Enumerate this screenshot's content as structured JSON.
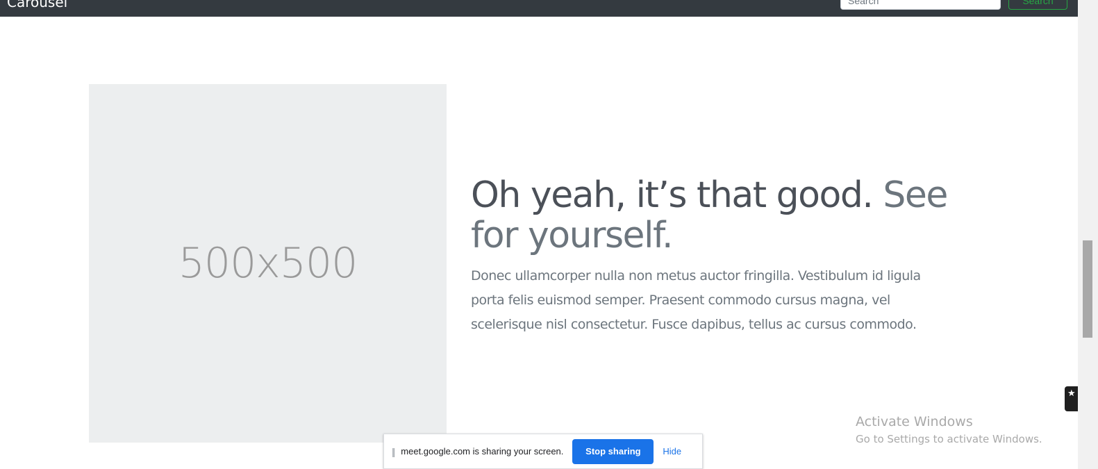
{
  "navbar": {
    "brand": "Carousel",
    "search_placeholder": "Search",
    "search_button": "Search"
  },
  "featurette": {
    "image_label": "500x500",
    "heading_main": "Oh yeah, it’s that good.",
    "heading_muted": "See for yourself.",
    "lead": "Donec ullamcorper nulla non metus auctor fringilla. Vestibulum id ligula porta felis euismod semper. Praesent commodo cursus magna, vel scelerisque nisl consectetur. Fusce dapibus, tellus ac cursus commodo."
  },
  "watermark": {
    "title": "Activate Windows",
    "subtitle": "Go to Settings to activate Windows."
  },
  "share_bar": {
    "grip": "||",
    "message": "meet.google.com is sharing your screen.",
    "stop_label": "Stop sharing",
    "hide_label": "Hide"
  },
  "icons": {
    "grip": "drag-handle-icon",
    "star": "star-icon",
    "camera": "camera-icon"
  },
  "colors": {
    "navbar": "#343a40",
    "accent_blue": "#1a73e8",
    "success_green": "#28a745",
    "muted_text": "#6c757d",
    "placeholder_bg": "#eceeef"
  }
}
